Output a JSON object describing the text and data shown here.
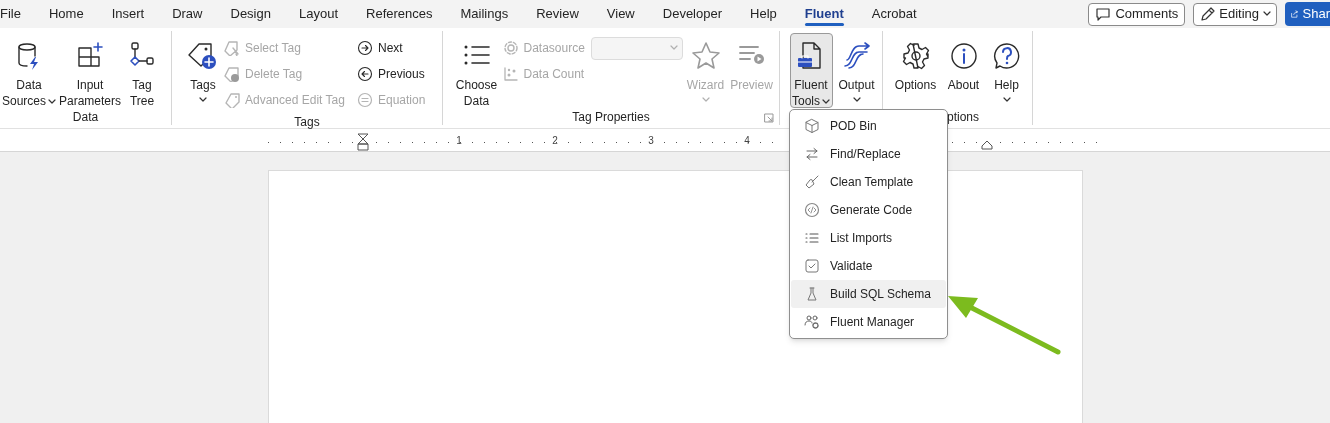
{
  "tabs": [
    {
      "label": "File",
      "selected": false
    },
    {
      "label": "Home",
      "selected": false
    },
    {
      "label": "Insert",
      "selected": false
    },
    {
      "label": "Draw",
      "selected": false
    },
    {
      "label": "Design",
      "selected": false
    },
    {
      "label": "Layout",
      "selected": false
    },
    {
      "label": "References",
      "selected": false
    },
    {
      "label": "Mailings",
      "selected": false
    },
    {
      "label": "Review",
      "selected": false
    },
    {
      "label": "View",
      "selected": false
    },
    {
      "label": "Developer",
      "selected": false
    },
    {
      "label": "Help",
      "selected": false
    },
    {
      "label": "Fluent",
      "selected": true
    },
    {
      "label": "Acrobat",
      "selected": false
    }
  ],
  "top_buttons": [
    {
      "label": "Comments",
      "kind": "comments"
    },
    {
      "label": "Editing",
      "kind": "editing"
    },
    {
      "label": "Shar",
      "kind": "share"
    }
  ],
  "groups": [
    {
      "label": "Data",
      "columns": [
        {
          "kind": "large",
          "lines": [
            "Data",
            "Sources"
          ],
          "dropdown": true,
          "pressed": false,
          "disabled": false
        },
        {
          "kind": "large",
          "lines": [
            "Input",
            "Parameters"
          ],
          "dropdown": false,
          "pressed": false,
          "disabled": false
        },
        {
          "kind": "large",
          "lines": [
            "Tag",
            "Tree"
          ],
          "dropdown": false,
          "pressed": false,
          "disabled": false
        }
      ]
    },
    {
      "label": "Tags",
      "columns": [
        {
          "kind": "large",
          "lines": [
            "Tags"
          ],
          "dropdown": true,
          "pressed": false,
          "disabled": false
        },
        {
          "kind": "small",
          "items": [
            {
              "label": "Select Tag",
              "disabled": true
            },
            {
              "label": "Delete Tag",
              "disabled": true
            },
            {
              "label": "Advanced Edit Tag",
              "disabled": true
            }
          ]
        },
        {
          "kind": "small",
          "items": [
            {
              "label": "Next",
              "disabled": false
            },
            {
              "label": "Previous",
              "disabled": false
            },
            {
              "label": "Equation",
              "disabled": true
            }
          ]
        }
      ]
    },
    {
      "label": "Tag Properties",
      "launcher": true,
      "columns": [
        {
          "kind": "large",
          "lines": [
            "Choose",
            "Data"
          ],
          "dropdown": false,
          "pressed": false,
          "disabled": false
        },
        {
          "kind": "small",
          "items": [
            {
              "label": "Datasource",
              "disabled": true,
              "combo": true
            },
            {
              "label": "Data Count",
              "disabled": true
            }
          ]
        },
        {
          "kind": "large",
          "lines": [
            "Wizard"
          ],
          "dropdown": true,
          "pressed": false,
          "disabled": true
        },
        {
          "kind": "large",
          "lines": [
            "Preview"
          ],
          "dropdown": false,
          "pressed": false,
          "disabled": true
        }
      ]
    },
    {
      "columns": [
        {
          "kind": "large",
          "lines": [
            "Fluent",
            "Tools"
          ],
          "dropdown": true,
          "pressed": true,
          "disabled": false
        },
        {
          "kind": "large",
          "lines": [
            "Output"
          ],
          "dropdown": true,
          "pressed": false,
          "disabled": false
        }
      ]
    },
    {
      "label": "ptions",
      "columns": [
        {
          "kind": "large",
          "lines": [
            "Options"
          ],
          "dropdown": false,
          "pressed": false,
          "disabled": false
        },
        {
          "kind": "large",
          "lines": [
            "About"
          ],
          "dropdown": false,
          "pressed": false,
          "disabled": false
        },
        {
          "kind": "large",
          "lines": [
            "Help"
          ],
          "dropdown": true,
          "pressed": false,
          "disabled": false
        }
      ]
    }
  ],
  "ruler": {
    "numbers": [
      "1",
      "2",
      "3",
      "4"
    ]
  },
  "menu": [
    {
      "label": "POD Bin",
      "highlighted": false
    },
    {
      "label": "Find/Replace",
      "highlighted": false
    },
    {
      "label": "Clean Template",
      "highlighted": false
    },
    {
      "label": "Generate Code",
      "highlighted": false
    },
    {
      "label": "List Imports",
      "highlighted": false
    },
    {
      "label": "Validate",
      "highlighted": false
    },
    {
      "label": "Build SQL Schema",
      "highlighted": true
    },
    {
      "label": "Fluent Manager",
      "highlighted": false
    }
  ]
}
